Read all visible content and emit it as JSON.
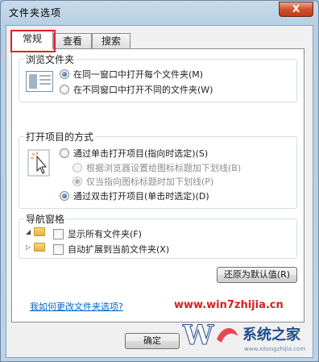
{
  "window": {
    "title": "文件夹选项",
    "close_glyph": "X"
  },
  "tabs": [
    {
      "label": "常规",
      "active": true
    },
    {
      "label": "查看",
      "active": false
    },
    {
      "label": "搜索",
      "active": false
    }
  ],
  "browse_group": {
    "title": "浏览文件夹",
    "options": [
      {
        "label": "在同一窗口中打开每个文件夹(M)",
        "checked": true
      },
      {
        "label": "在不同窗口中打开不同的文件夹(W)",
        "checked": false
      }
    ]
  },
  "open_group": {
    "title": "打开项目的方式",
    "options": [
      {
        "label": "通过单击打开项目(指向时选定)(S)",
        "checked": false,
        "disabled": false
      },
      {
        "label": "根据浏览器设置给图标标题加下划线(B)",
        "checked": false,
        "disabled": true
      },
      {
        "label": "仅当指向图标标题时加下划线(P)",
        "checked": true,
        "disabled": true
      },
      {
        "label": "通过双击打开项目(单击时选定)(D)",
        "checked": true,
        "disabled": false
      }
    ]
  },
  "nav_group": {
    "title": "导航窗格",
    "options": [
      {
        "label": "显示所有文件夹(F)",
        "checked": false
      },
      {
        "label": "自动扩展到当前文件夹(X)",
        "checked": false
      }
    ]
  },
  "restore_button": "还原为默认值(R)",
  "help_link": "我如何更改文件夹选项?",
  "ok_button": "确定",
  "watermark": {
    "url": "www.win7zhijia.cn",
    "brand": "系统之家",
    "sub_url": "www.xitongzhijia.com"
  },
  "colors": {
    "highlight_box": "#e0202a",
    "link": "#0066cc",
    "close_button": "#d2532f"
  }
}
